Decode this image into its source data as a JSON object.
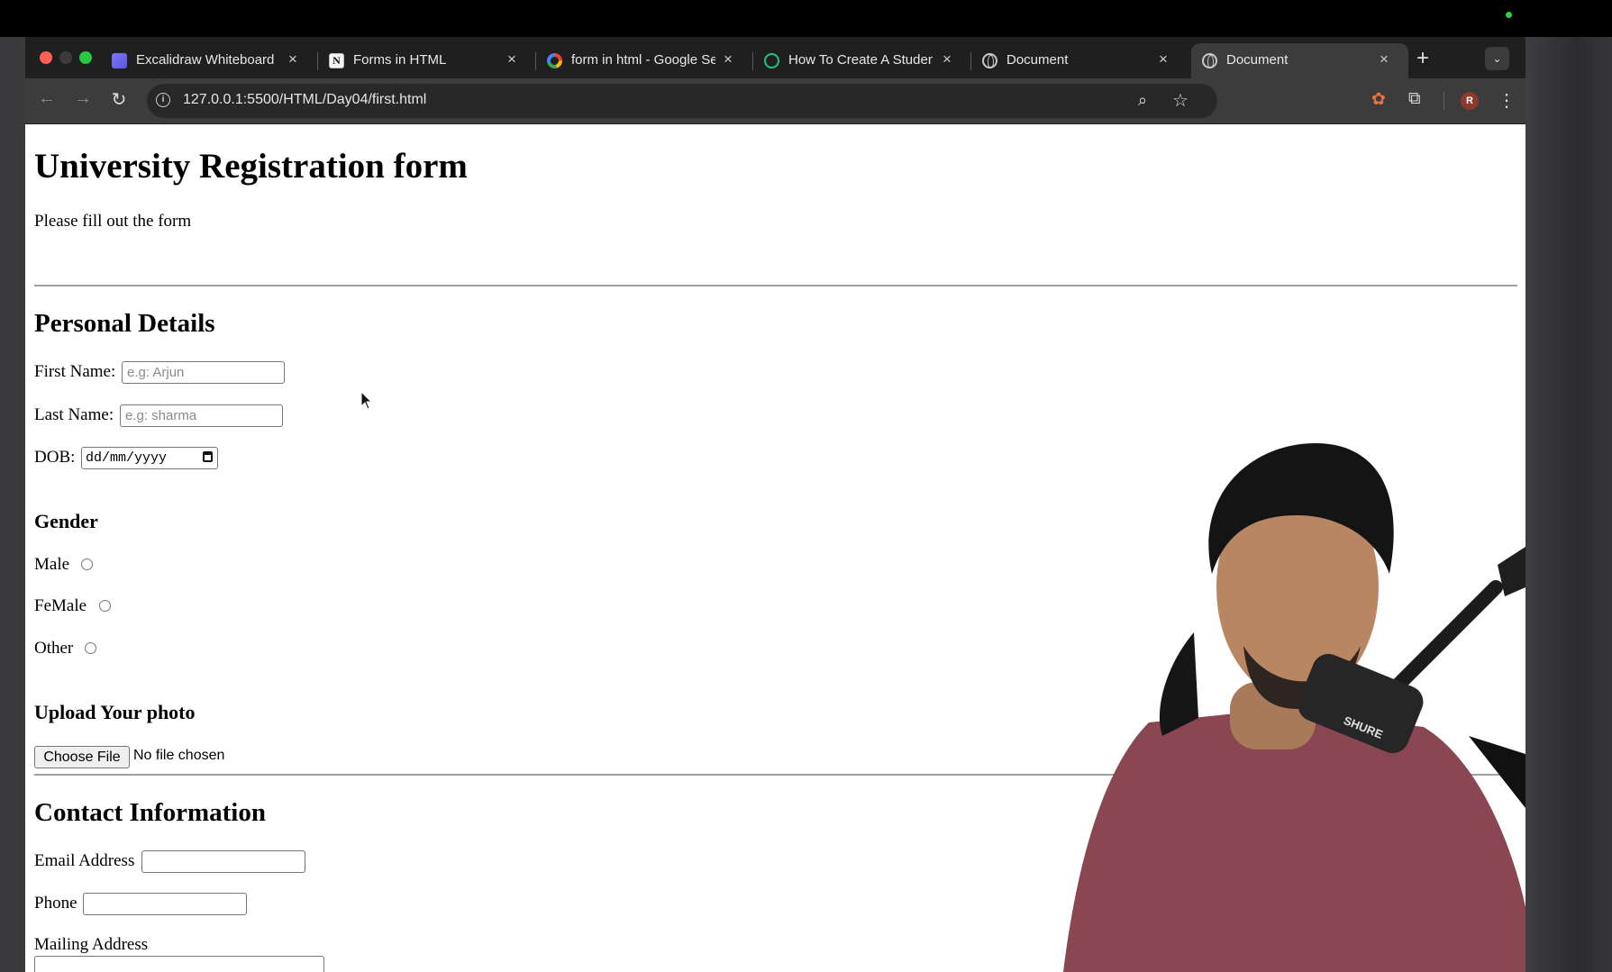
{
  "browser": {
    "tabs": [
      {
        "title": "Excalidraw Whiteboard",
        "icon": "excalidraw-icon"
      },
      {
        "title": "Forms in HTML",
        "icon": "notion-icon"
      },
      {
        "title": "form in html - Google Sea",
        "icon": "google-icon"
      },
      {
        "title": "How To Create A Student",
        "icon": "site-icon"
      },
      {
        "title": "Document",
        "icon": "globe-icon"
      },
      {
        "title": "Document",
        "icon": "globe-icon",
        "active": true
      }
    ],
    "notion_glyph": "N",
    "address_bar": "127.0.0.1:5500/HTML/Day04/first.html",
    "profile_initial": "R",
    "new_tab_symbol": "+",
    "tab_menu_symbol": "⌄"
  },
  "page": {
    "title": "University Registration form",
    "intro": "Please fill out the form",
    "personal": {
      "heading": "Personal Details",
      "first_name_label": "First Name:",
      "first_name_placeholder": "e.g: Arjun",
      "last_name_label": "Last Name:",
      "last_name_placeholder": "e.g: sharma",
      "dob_label": "DOB:",
      "dob_value": "dd/mm/yyyy"
    },
    "gender": {
      "heading": "Gender",
      "options": [
        "Male",
        "FeMale",
        "Other"
      ]
    },
    "upload": {
      "heading": "Upload Your photo",
      "button": "Choose File",
      "status": "No file chosen"
    },
    "contact": {
      "heading": "Contact Information",
      "email_label": "Email Address",
      "phone_label": "Phone",
      "mailing_label": "Mailing Address"
    }
  },
  "overlay": {
    "mic_brand": "SHURE"
  },
  "colors": {
    "chrome_dark": "#1f1f1f",
    "chrome_toolbar": "#3c3c3c",
    "page_bg": "#ffffff",
    "close_red": "#ff5f57",
    "maximize_green": "#28c840"
  }
}
